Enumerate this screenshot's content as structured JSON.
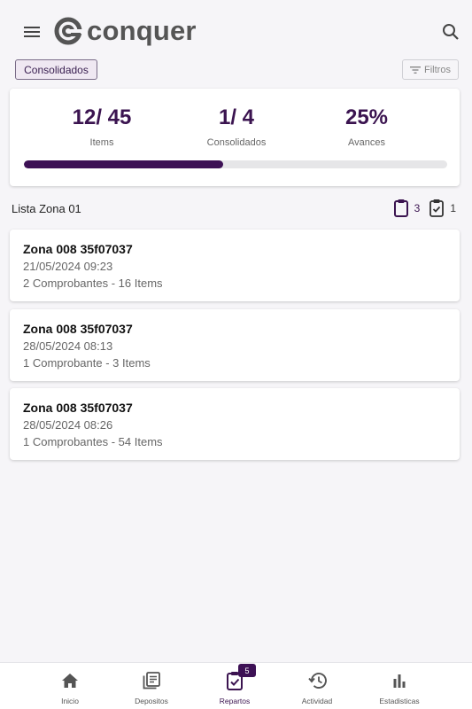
{
  "header": {
    "brand": "conquer",
    "menu_icon": "hamburger-menu-icon",
    "search_icon": "search-icon"
  },
  "filter_bar": {
    "chip_label": "Consolidados",
    "filters_label": "Filtros"
  },
  "summary": {
    "items_value": "12/ 45",
    "items_label": "Items",
    "consolidados_value": "1/ 4",
    "consolidados_label": "Consolidados",
    "avances_value": "25%",
    "avances_label": "Avances",
    "progress_fraction": 0.47
  },
  "list": {
    "title": "Lista Zona 01",
    "pending_count": "3",
    "done_count": "1"
  },
  "cards": [
    {
      "title": "Zona 008 35f07037",
      "date": "21/05/2024 09:23",
      "desc": "2 Comprobantes - 16 Items"
    },
    {
      "title": "Zona 008 35f07037",
      "date": "28/05/2024 08:13",
      "desc": "1 Comprobante - 3 Items"
    },
    {
      "title": "Zona 008 35f07037",
      "date": "28/05/2024 08:26",
      "desc": "1 Comprobantes - 54 Items"
    }
  ],
  "nav": {
    "items": [
      {
        "label": "Inicio",
        "icon": "home-icon"
      },
      {
        "label": "Depositos",
        "icon": "list-document-icon"
      },
      {
        "label": "Repartos",
        "icon": "clipboard-check-icon",
        "badge": "5"
      },
      {
        "label": "Actividad",
        "icon": "history-icon"
      },
      {
        "label": "Estadisticas",
        "icon": "bar-chart-icon"
      }
    ]
  },
  "colors": {
    "accent": "#3d1155",
    "background": "#f6f5f8"
  }
}
